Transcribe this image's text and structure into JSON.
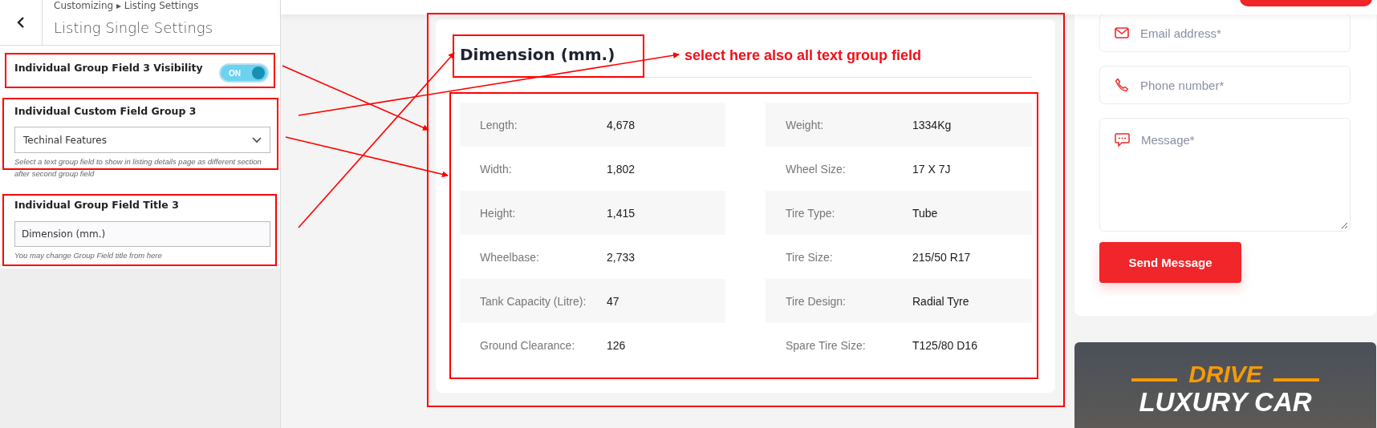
{
  "sidebar": {
    "breadcrumb": "Customizing ▸ Listing Settings",
    "title": "Listing Single Settings",
    "controls": [
      {
        "kind": "toggle",
        "label": "Individual Group Field 3 Visibility",
        "on": true,
        "toggle_text": "ON"
      },
      {
        "kind": "select",
        "label": "Individual Custom Field Group 3",
        "value": "Techinal Features",
        "description": "Select a text group field to show in listing details page as different section after second group field"
      },
      {
        "kind": "text",
        "label": "Individual Group Field Title 3",
        "value": "Dimension (mm.)",
        "description": "You may change Group Field title from here"
      }
    ]
  },
  "spec_card": {
    "title": "Dimension (mm.)",
    "specs": [
      {
        "label": "Length:",
        "value": "4,678"
      },
      {
        "label": "Weight:",
        "value": "1334Kg"
      },
      {
        "label": "Width:",
        "value": "1,802"
      },
      {
        "label": "Wheel Size:",
        "value": "17 X 7J"
      },
      {
        "label": "Height:",
        "value": "1,415"
      },
      {
        "label": "Tire Type:",
        "value": "Tube"
      },
      {
        "label": "Wheelbase:",
        "value": "2,733"
      },
      {
        "label": "Tire Size:",
        "value": "215/50 R17"
      },
      {
        "label": "Tank Capacity (Litre):",
        "value": "47"
      },
      {
        "label": "Tire Design:",
        "value": "Radial Tyre"
      },
      {
        "label": "Ground Clearance:",
        "value": "126"
      },
      {
        "label": "Spare Tire Size:",
        "value": "T125/80 D16"
      }
    ]
  },
  "contact_form": {
    "fields": [
      {
        "kind": "email",
        "placeholder": "Email address*"
      },
      {
        "kind": "phone",
        "placeholder": "Phone number*"
      },
      {
        "kind": "message",
        "placeholder": "Message*"
      }
    ],
    "submit": "Send Message"
  },
  "banner": {
    "line_1": "DRIVE",
    "line_2": "LUXURY CAR"
  },
  "annotation": {
    "note": "select here also all text group field"
  }
}
